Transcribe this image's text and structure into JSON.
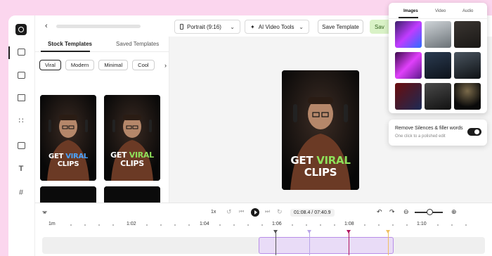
{
  "topbar": {
    "format_label": "Portrait (9:16)",
    "tools_label": "AI Video Tools",
    "save_template_label": "Save Template",
    "save_label": "Sav"
  },
  "left_panel": {
    "tabs": [
      {
        "label": "Stock Templates",
        "active": true
      },
      {
        "label": "Saved Templates",
        "active": false
      }
    ],
    "chips": [
      "Viral",
      "Modern",
      "Minimal",
      "Cool"
    ],
    "templates": [
      {
        "caption_line1": "GET",
        "caption_highlight": "VIRAL",
        "caption_line2": "CLIPS",
        "highlight_color": "#4aa3ff"
      },
      {
        "caption_line1": "GET",
        "caption_highlight": "VIRAL",
        "caption_line2": "CLIPS",
        "highlight_color": "#8ee05a"
      }
    ]
  },
  "preview": {
    "caption_line1": "GET",
    "caption_highlight": "VIRAL",
    "caption_line2": "CLIPS",
    "highlight_color": "#8ee05a"
  },
  "timeline": {
    "speed": "1x",
    "timecode": "01:08.4 / 07:40.9",
    "ruler_labels": [
      "1m",
      "1:02",
      "1:04",
      "1:06",
      "1:08",
      "1:10"
    ]
  },
  "media_popup": {
    "tabs": [
      {
        "label": "Images",
        "active": true
      },
      {
        "label": "Video",
        "active": false
      },
      {
        "label": "Audio",
        "active": false
      }
    ]
  },
  "silence_card": {
    "title": "Remove Silences & filler words",
    "subtitle": "One click to a polished edit",
    "enabled": true
  },
  "colors": {
    "background": "#fbd6ee",
    "accent_green": "#d9f2c6",
    "clip_purple": "#b98ee8"
  }
}
